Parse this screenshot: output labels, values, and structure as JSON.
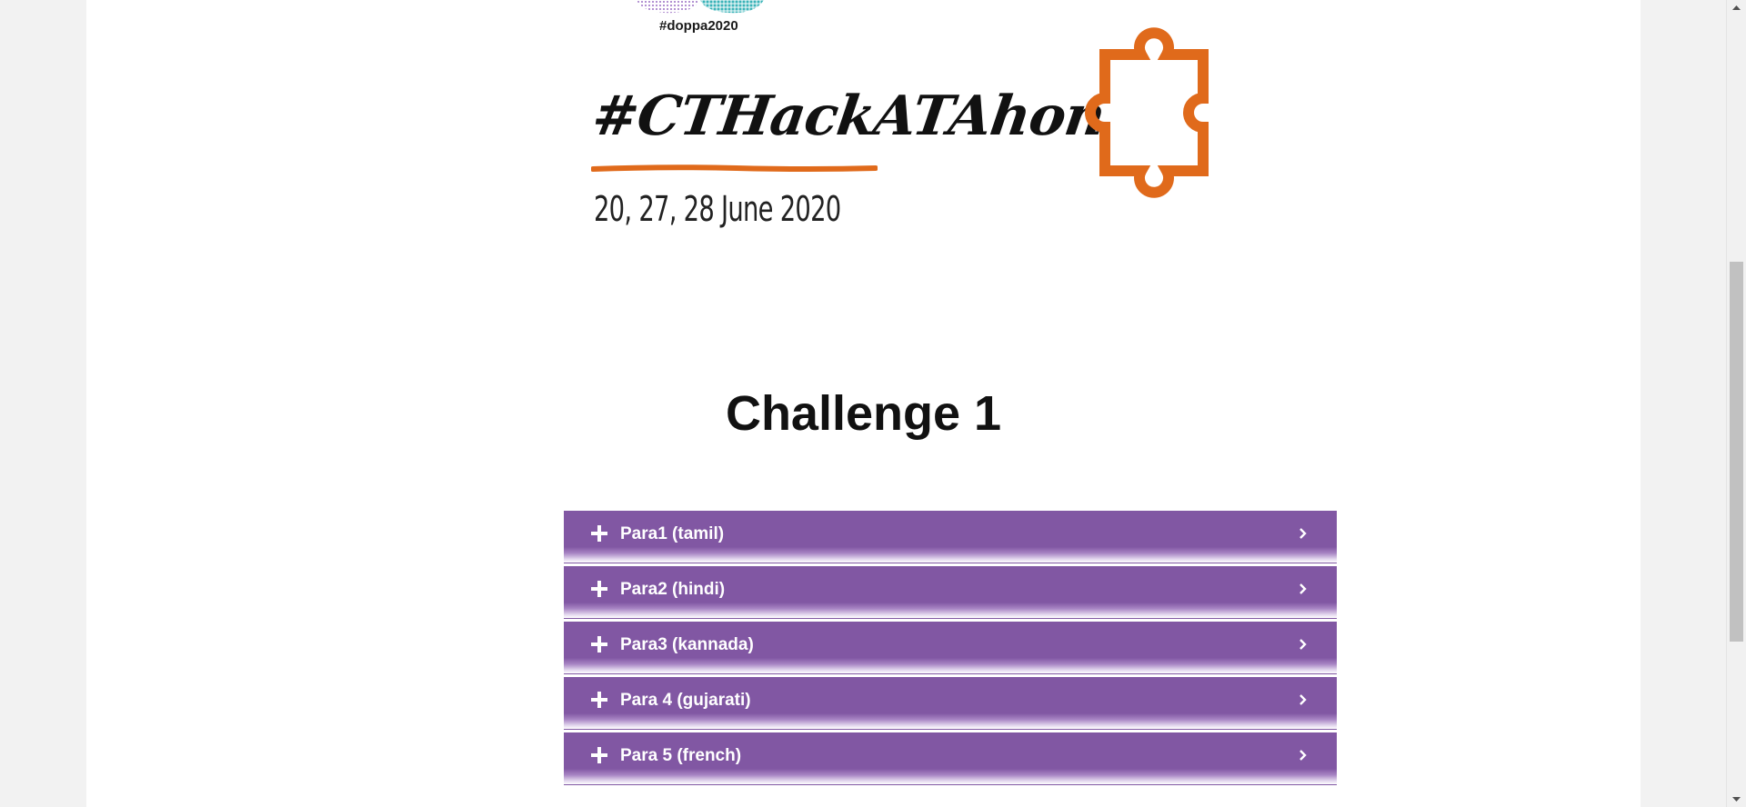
{
  "banner": {
    "hashtag_small": "#doppa2020",
    "title": "#CTHackATAhon",
    "dates": "20, 27, 28 June 2020",
    "accent_color": "#e06a1b"
  },
  "challenge": {
    "title": "Challenge 1"
  },
  "accordion": {
    "color": "#8157a3",
    "items": [
      {
        "label": "Para1 (tamil)"
      },
      {
        "label": "Para2 (hindi)"
      },
      {
        "label": "Para3 (kannada)"
      },
      {
        "label": "Para 4 (gujarati)"
      },
      {
        "label": "Para 5 (french)"
      }
    ]
  },
  "icons": {
    "expand": "plus-icon",
    "open": "chevron-right-icon",
    "scroll_up": "arrow-up-icon",
    "scroll_down": "arrow-down-icon"
  }
}
